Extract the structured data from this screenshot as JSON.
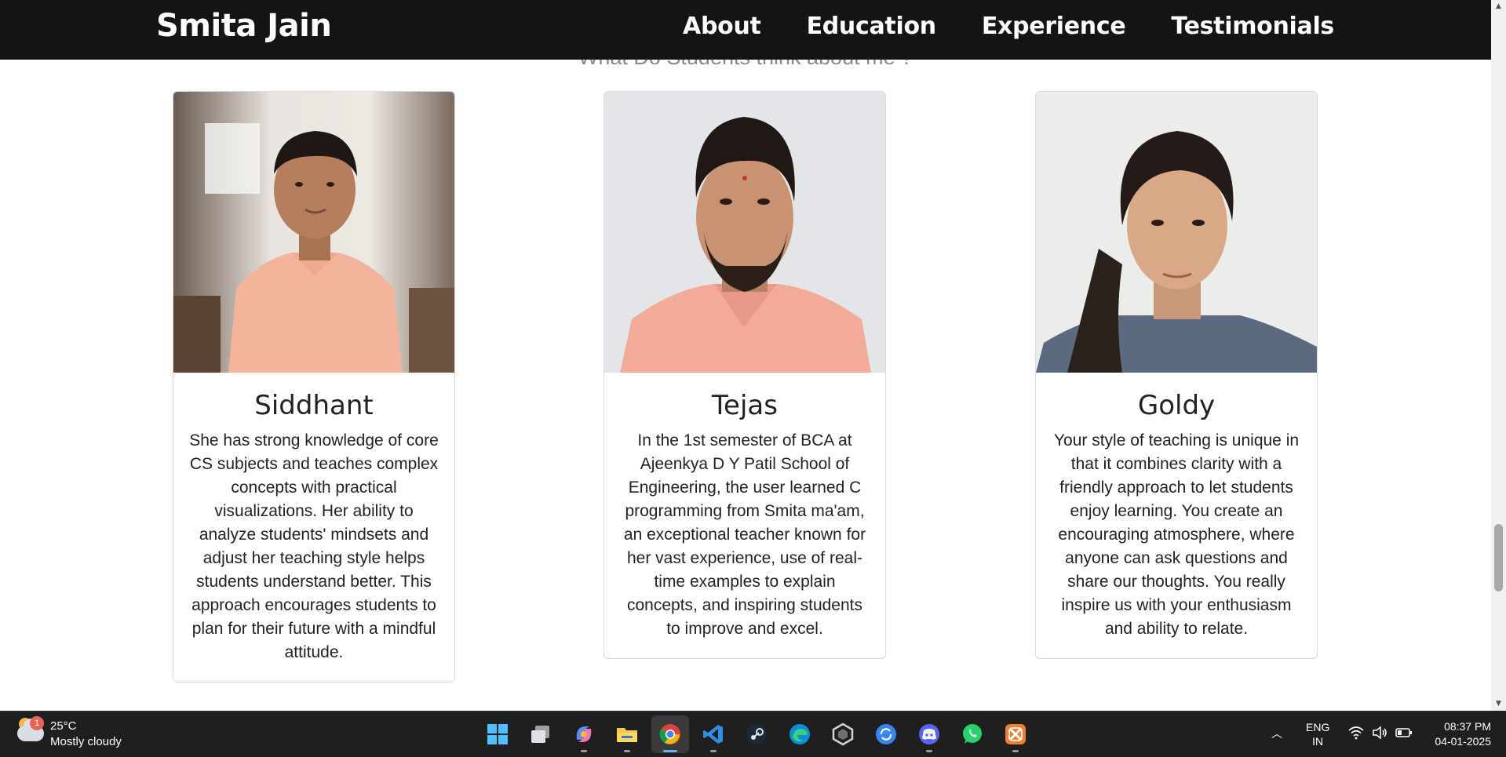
{
  "navbar": {
    "brand": "Smita Jain",
    "links": [
      "About",
      "Education",
      "Experience",
      "Testimonials"
    ]
  },
  "section": {
    "heading": "What Do Students think about me ?"
  },
  "testimonials": [
    {
      "name": "Siddhant",
      "text": "She has strong knowledge of core CS subjects and teaches complex concepts with practical visualizations. Her ability to analyze students' mindsets and adjust her teaching style helps students understand better. This approach encourages students to plan for their future with a mindful attitude."
    },
    {
      "name": "Tejas",
      "text": "In the 1st semester of BCA at Ajeenkya D Y Patil School of Engineering, the user learned C programming from Smita ma'am, an exceptional teacher known for her vast experience, use of real-time examples to explain concepts, and inspiring students to improve and excel."
    },
    {
      "name": "Goldy",
      "text": "Your style of teaching is unique in that it combines clarity with a friendly approach to let students enjoy learning. You create an encouraging atmosphere, where anyone can ask questions and share our thoughts. You really inspire us with your enthusiasm and ability to relate."
    }
  ],
  "taskbar": {
    "weather": {
      "badge": "1",
      "temp": "25°C",
      "desc": "Mostly cloudy"
    },
    "apps": [
      "start-icon",
      "task-view-icon",
      "copilot-icon",
      "file-explorer-icon",
      "chrome-icon",
      "vscode-icon",
      "steam-icon",
      "edge-icon",
      "unity-icon",
      "sync-icon",
      "discord-icon",
      "whatsapp-icon",
      "xampp-icon"
    ],
    "tray": {
      "lang_top": "ENG",
      "lang_bottom": "IN",
      "time": "08:37 PM",
      "date": "04-01-2025"
    }
  },
  "colors": {
    "navbar_bg": "#141414",
    "heading": "#8a8a8a",
    "taskbar_bg": "#1f1f1f",
    "accent": "#5fb2ff"
  }
}
